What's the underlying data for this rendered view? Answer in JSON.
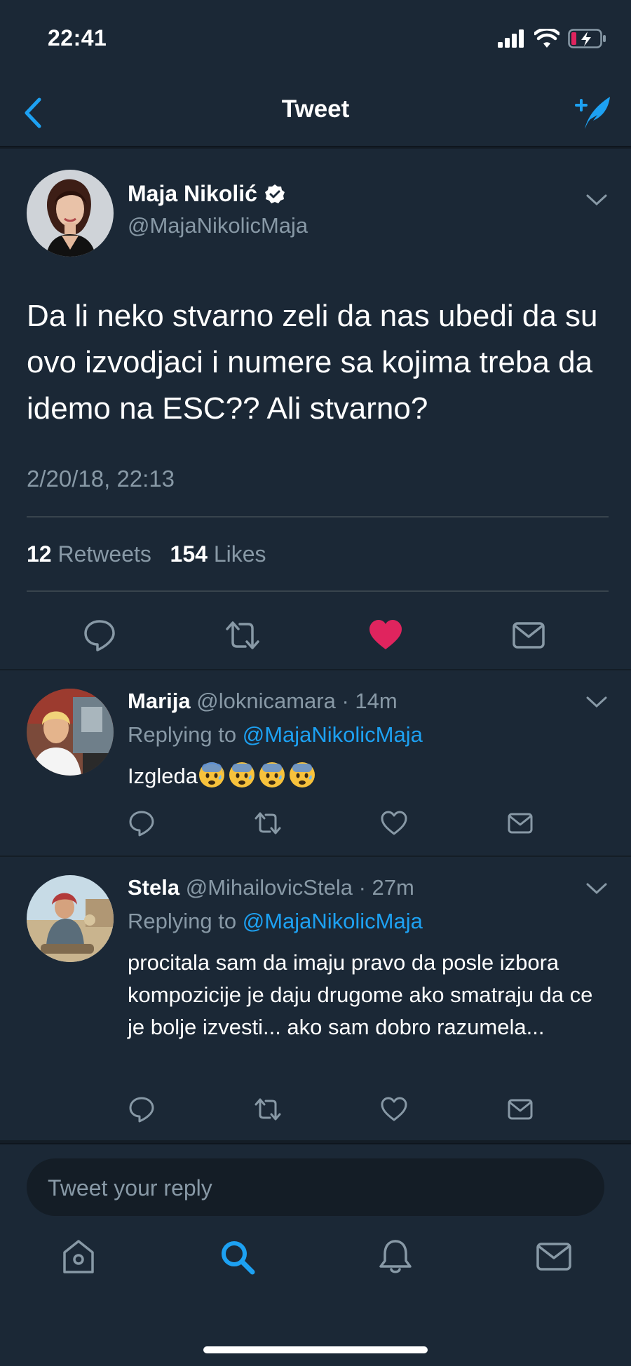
{
  "status_bar": {
    "time": "22:41"
  },
  "nav": {
    "title": "Tweet"
  },
  "main_tweet": {
    "author_name": "Maja Nikolić",
    "author_handle": "@MajaNikolicMaja",
    "verified": true,
    "text": "Da li neko stvarno zeli da nas ubedi da su ovo izvodjaci i numere sa kojima treba da idemo na ESC?? Ali stvarno?",
    "timestamp": "2/20/18, 22:13",
    "retweet_count": "12",
    "retweet_label": "Retweets",
    "like_count": "154",
    "like_label": "Likes",
    "liked": true
  },
  "replies": [
    {
      "name": "Marija",
      "handle": "@loknicamara",
      "time": "· 14m",
      "replying_label": "Replying to",
      "replying_to": "@MajaNikolicMaja",
      "text": "Izgleda",
      "emoji": [
        "anxious-face-with-sweat",
        "anxious-face-with-sweat",
        "anxious-face-with-sweat",
        "anxious-face-with-sweat"
      ]
    },
    {
      "name": "Stela",
      "handle": "@MihailovicStela",
      "time": "· 27m",
      "replying_label": "Replying to",
      "replying_to": "@MajaNikolicMaja",
      "text": "procitala sam da imaju pravo da posle izbora kompozicije je daju drugome ako smatraju da ce je bolje izvesti... ako sam dobro razumela..."
    }
  ],
  "composer": {
    "placeholder": "Tweet your reply"
  },
  "colors": {
    "accent": "#1da1f2",
    "like": "#e0245e",
    "background": "#1b2836",
    "muted": "#8899a6"
  }
}
